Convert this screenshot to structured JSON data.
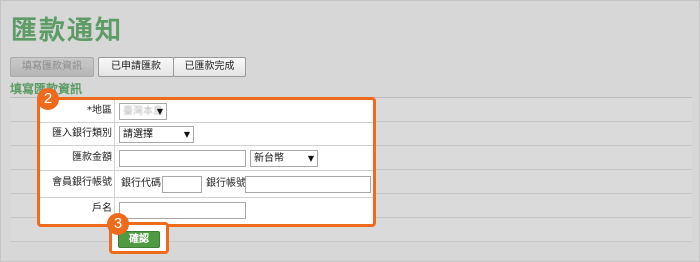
{
  "page": {
    "title": "匯款通知"
  },
  "tabs": [
    {
      "label": "填寫匯款資訊",
      "active": true
    },
    {
      "label": "已申請匯款",
      "active": false
    },
    {
      "label": "已匯款完成",
      "active": false
    }
  ],
  "section": {
    "title": "填寫匯款資訊"
  },
  "form": {
    "region": {
      "label": "*地區",
      "value": "臺灣本島"
    },
    "bank_type": {
      "label": "匯入銀行類別",
      "value": "請選擇"
    },
    "amount": {
      "label": "匯款金額",
      "value": "",
      "currency": "新台幣"
    },
    "account": {
      "label": "會員銀行帳號",
      "bank_code_label": "銀行代碼",
      "bank_code_value": "",
      "account_label": "銀行帳號",
      "account_value": ""
    },
    "holder": {
      "label": "戶名",
      "value": ""
    }
  },
  "steps": {
    "step2": "2",
    "step3": "3"
  },
  "confirm": {
    "label": "確認"
  },
  "colors": {
    "accent_green": "#5e9c66",
    "highlight_orange": "#ee6b1c",
    "button_green": "#4f9b42",
    "background": "#d7d7d7"
  }
}
